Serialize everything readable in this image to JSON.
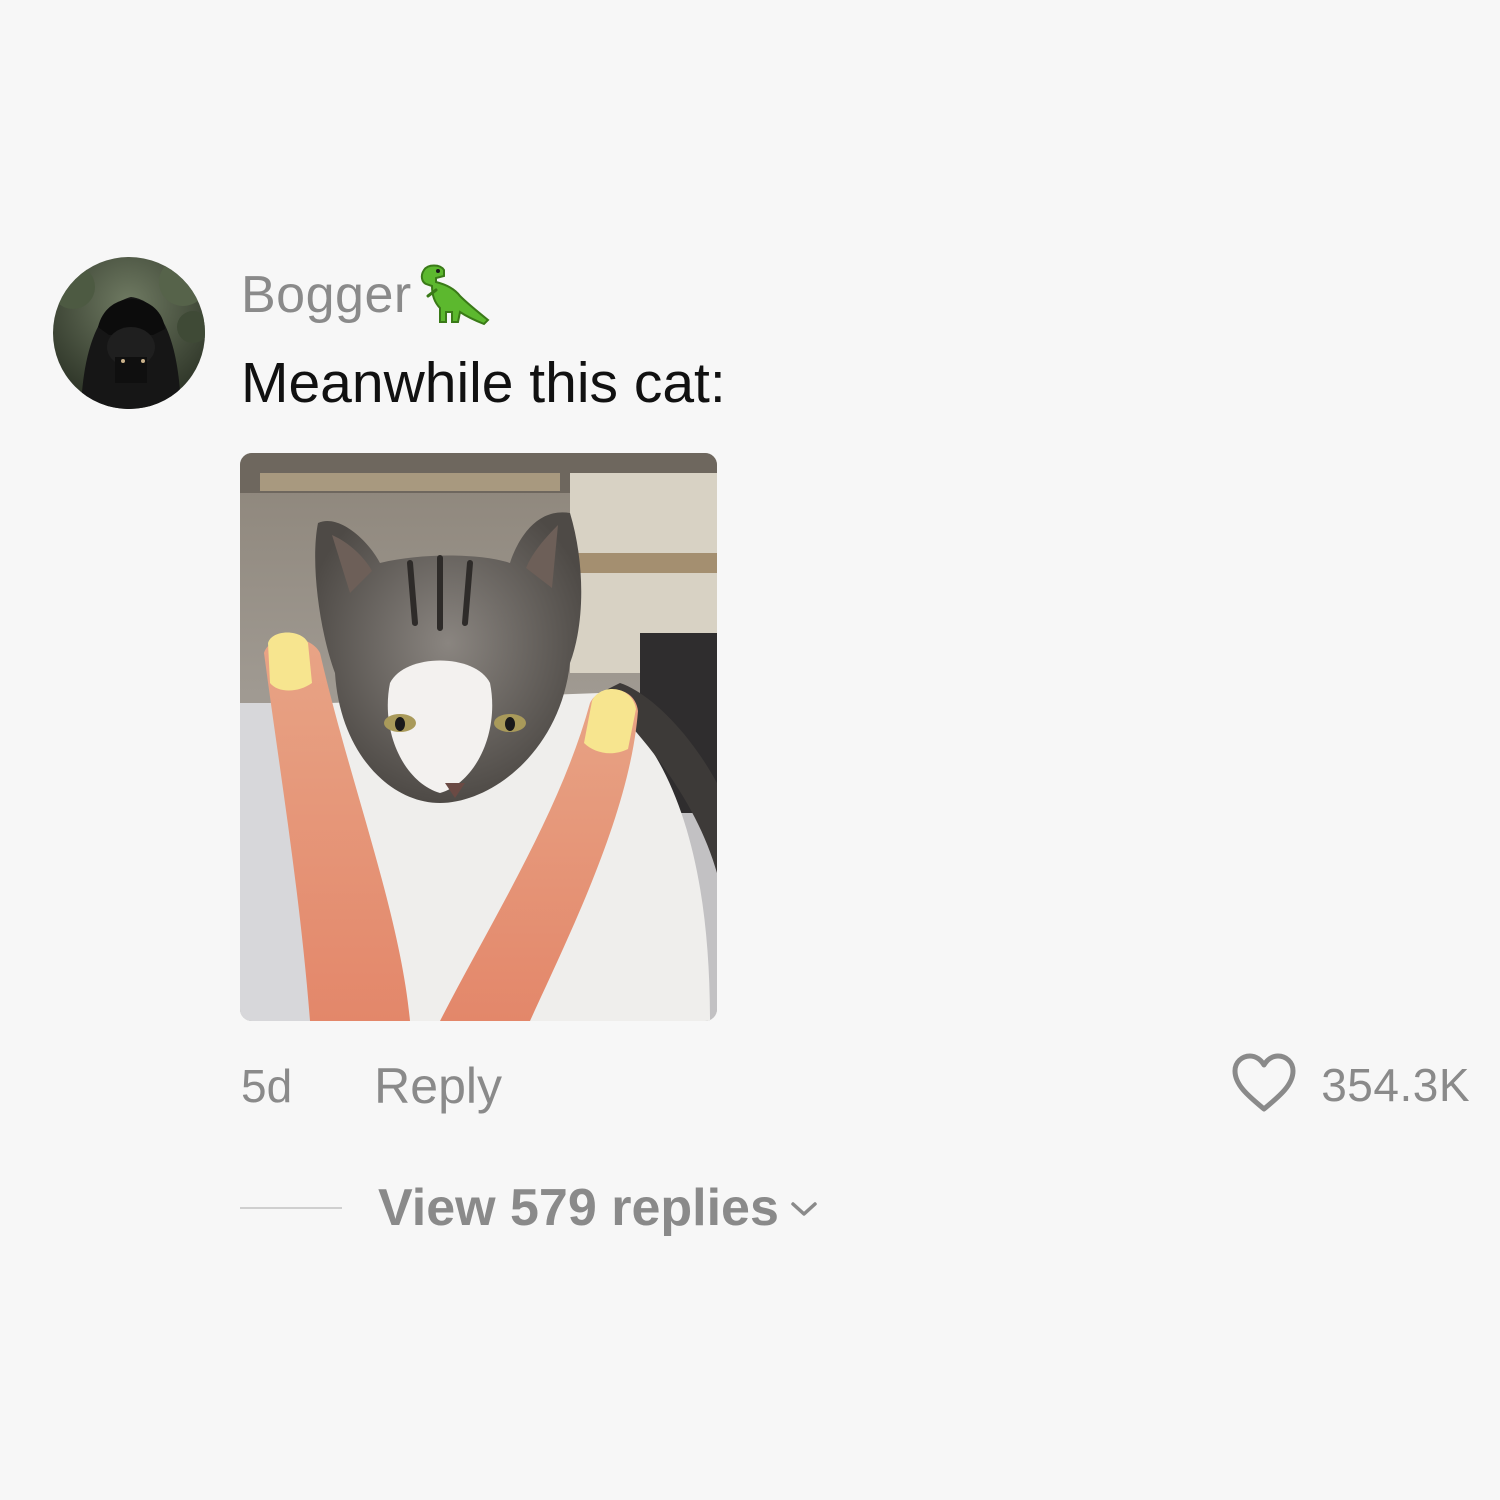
{
  "comment": {
    "author": "Bogger",
    "author_badge_icon": "t-rex-emoji-icon",
    "text": "Meanwhile this cat:",
    "timestamp": "5d",
    "reply_label": "Reply",
    "like_icon": "heart-outline-icon",
    "like_count": "354.3K",
    "view_replies_label": "View 579 replies",
    "view_replies_icon": "chevron-down-icon"
  },
  "colors": {
    "background": "#f7f7f7",
    "username": "#8a8a8a",
    "comment_text": "#111111",
    "secondary_text": "#8a8a8a"
  }
}
